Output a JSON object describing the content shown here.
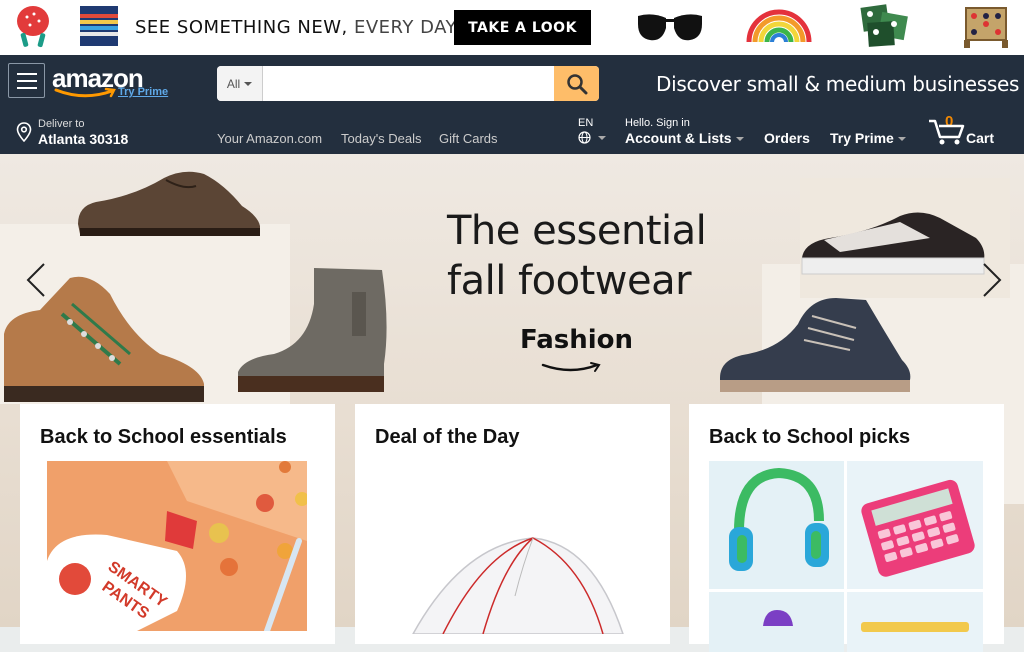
{
  "promo": {
    "text_bold": "SEE SOMETHING NEW,",
    "text_light": "EVERY DAY.",
    "cta": "TAKE A LOOK"
  },
  "header": {
    "logo": "amazon",
    "logo_prime": "Try Prime",
    "search": {
      "category": "All",
      "value": "",
      "placeholder": ""
    },
    "tagline": "Discover small & medium businesses"
  },
  "subnav": {
    "deliver_line1": "Deliver to",
    "deliver_line2": "Atlanta 30318",
    "links": [
      "Your Amazon.com",
      "Today's Deals",
      "Gift Cards"
    ],
    "language": "EN",
    "account_line1": "Hello. Sign in",
    "account_line2": "Account & Lists",
    "orders": "Orders",
    "try_prime": "Try Prime",
    "cart_count": "0",
    "cart_label": "Cart"
  },
  "hero": {
    "title_line1": "The essential",
    "title_line2": "fall footwear",
    "brand": "Fashion"
  },
  "cards": [
    {
      "title": "Back to School essentials"
    },
    {
      "title": "Deal of the Day"
    },
    {
      "title": "Back to School picks"
    }
  ],
  "colors": {
    "nav_bg": "#232f3e",
    "search_button": "#febd69",
    "cart_count": "#f08804",
    "prime_link": "#5fa9e8"
  }
}
